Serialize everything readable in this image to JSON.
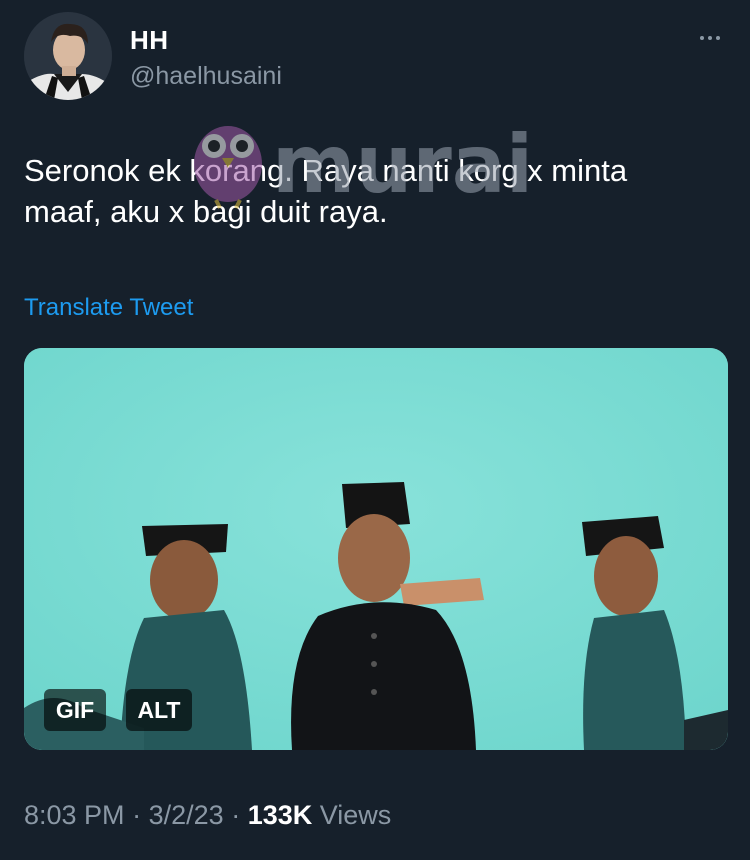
{
  "author": {
    "display_name": "HH",
    "handle": "@haelhusaini"
  },
  "tweet": {
    "text": "Seronok ek korang. Raya nanti korg x minta maaf, aku x bagi duit raya.",
    "translate_label": "Translate Tweet"
  },
  "watermark": {
    "text": "murai"
  },
  "media": {
    "gif_label": "GIF",
    "alt_label": "ALT"
  },
  "meta": {
    "time": "8:03 PM",
    "separator": "·",
    "date": "3/2/23",
    "views_count": "133K",
    "views_label": "Views"
  },
  "icons": {
    "more": "more-horizontal-icon",
    "watermark_logo": "owl-icon"
  },
  "colors": {
    "background": "#16202b",
    "text": "#ffffff",
    "secondary_text": "#8b98a5",
    "link": "#1d9bf0",
    "media_background": "#77dcd3"
  }
}
